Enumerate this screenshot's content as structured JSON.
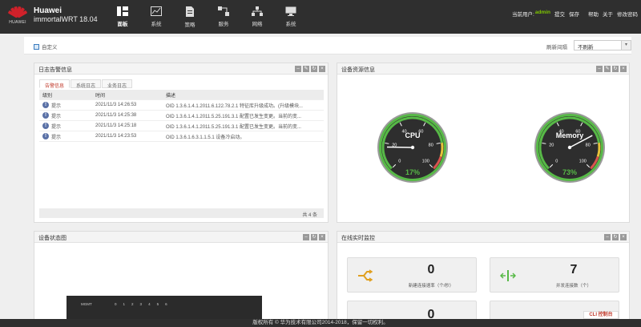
{
  "header": {
    "brand_text": "HUAWEI",
    "title": "Huawei",
    "subtitle": "immortalWRT 18.04",
    "nav": [
      {
        "label": "面板",
        "icon": "dashboard-icon"
      },
      {
        "label": "系统",
        "icon": "chart-icon"
      },
      {
        "label": "策略",
        "icon": "document-icon"
      },
      {
        "label": "服务",
        "icon": "service-icon"
      },
      {
        "label": "网络",
        "icon": "network-icon"
      },
      {
        "label": "系统",
        "icon": "monitor-icon"
      }
    ],
    "user_label": "当前用户:",
    "user_name": "admin",
    "links": [
      "提交",
      "保存",
      "帮助",
      "关于",
      "修改密码"
    ]
  },
  "subheader": {
    "custom_label": "自定义",
    "refresh_label": "刷新间隔",
    "refresh_value": "不刷新"
  },
  "log_panel": {
    "title": "日志告警信息",
    "tabs": [
      "告警信息",
      "系统日志",
      "业务日志"
    ],
    "columns": [
      "级别",
      "时间",
      "描述"
    ],
    "rows": [
      {
        "level": "提示",
        "time": "2021/11/3 14:26:53",
        "desc": "OID 1.3.6.1.4.1.2011.6.122.78.2.1 特征库升级成功。(升级模块..."
      },
      {
        "level": "提示",
        "time": "2021/11/3 14:25:38",
        "desc": "OID 1.3.6.1.4.1.2011.5.25.191.3.1 配置已发生变更。当前的变..."
      },
      {
        "level": "提示",
        "time": "2021/11/3 14:25:18",
        "desc": "OID 1.3.6.1.4.1.2011.5.25.191.3.1 配置已发生变更。当前的变..."
      },
      {
        "level": "提示",
        "time": "2021/11/3 14:23:53",
        "desc": "OID 1.3.6.1.6.3.1.1.5.1 设备冷启动。"
      }
    ],
    "footer": "共 4 条"
  },
  "resource_panel": {
    "title": "设备资源信息",
    "gauges": [
      {
        "label": "CPU",
        "value": 17,
        "value_text": "17%"
      },
      {
        "label": "Memory",
        "value": 73,
        "value_text": "73%"
      }
    ],
    "gauge_ticks": [
      "0",
      "20",
      "40",
      "60",
      "80",
      "100"
    ]
  },
  "device_panel": {
    "title": "设备状态图",
    "device_label": "MGMT",
    "port_labels": [
      "0",
      "1",
      "2",
      "3",
      "4",
      "5",
      "6"
    ]
  },
  "monitor_panel": {
    "title": "在线实时监控",
    "cards": [
      {
        "value": "0",
        "label": "新建连接速率（个/秒）"
      },
      {
        "value": "7",
        "label": "并发连接数（个）"
      }
    ],
    "partial_card_value": "0"
  },
  "footer": {
    "text": "版权所有 © 华为技术有限公司2014-2018，保留一切权利。",
    "cli_label": "CLI 控制台"
  },
  "colors": {
    "topbar": "#2f2f2f",
    "accent_red": "#d0212a",
    "user_green": "#7ec600",
    "gauge_green": "#57b947"
  }
}
